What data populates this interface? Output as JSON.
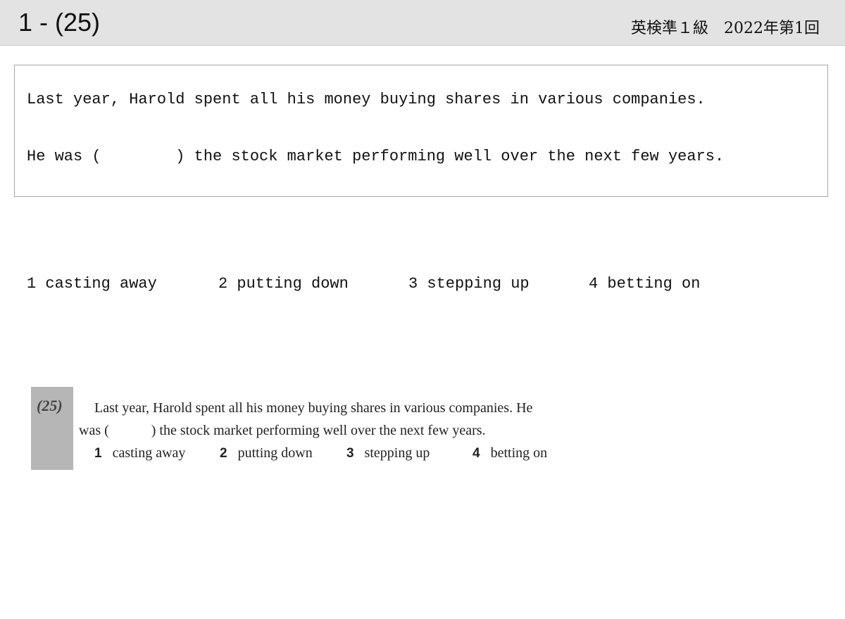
{
  "header": {
    "title": "1 - (25)",
    "exam": "英検準１級　2022年第1回"
  },
  "question": {
    "line1": "Last year, Harold spent all his money buying shares in various companies.",
    "line2": "He was (        ) the stock market performing well over the next few years."
  },
  "options": [
    {
      "label": "1 casting away"
    },
    {
      "label": "2 putting down"
    },
    {
      "label": "3 stepping up"
    },
    {
      "label": "4 betting on"
    }
  ],
  "original": {
    "number": "(25)",
    "line1": "Last year, Harold spent all his money buying shares in various companies. He",
    "line2": "was (            ) the stock market performing well over the next few years.",
    "options": [
      {
        "num": "1",
        "text": "casting away"
      },
      {
        "num": "2",
        "text": "putting down"
      },
      {
        "num": "3",
        "text": "stepping up"
      },
      {
        "num": "4",
        "text": "betting on"
      }
    ]
  }
}
